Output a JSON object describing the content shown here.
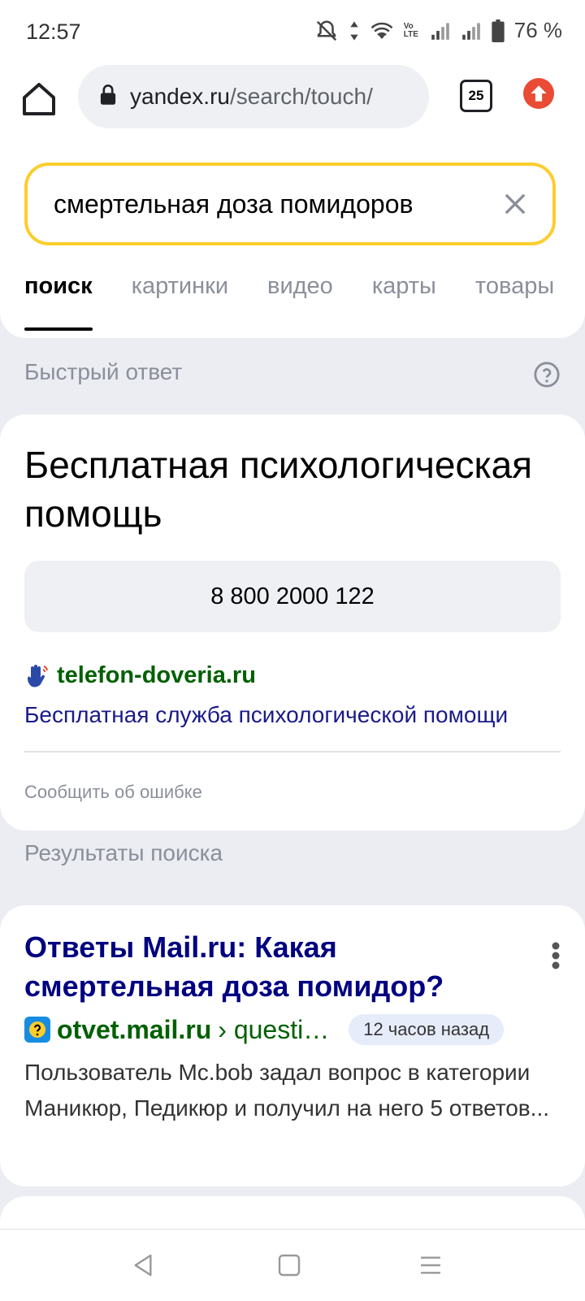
{
  "status": {
    "time": "12:57",
    "battery": "76 %",
    "volte": "Vo LTE"
  },
  "browser": {
    "url_domain": "yandex.ru",
    "url_path": "/search/touch/",
    "tab_count": "25"
  },
  "search": {
    "query": "смертельная доза помидоров",
    "tabs": [
      "поиск",
      "картинки",
      "видео",
      "карты",
      "товары"
    ],
    "active_tab": "поиск"
  },
  "quick_answer": {
    "header": "Быстрый ответ",
    "title": "Бесплатная психологическая помощь",
    "phone": "8 800 2000 122",
    "source_domain": "telefon-doveria.ru",
    "source_desc": "Бесплатная служба психологической помощи",
    "report": "Сообщить об ошибке"
  },
  "results": {
    "header": "Результаты поиска",
    "items": [
      {
        "title": "Ответы Mail.ru: Какая смертельная доза помидор?",
        "domain": "otvet.mail.ru",
        "path": "› questi…",
        "time": "12 часов назад",
        "snippet": "Пользователь Mc.bob задал вопрос в категории Маникюр, Педикюр и получил на него 5 ответов..."
      }
    ]
  },
  "colors": {
    "accent_yellow": "#fdcd2d",
    "link_blue": "#000080",
    "domain_green": "#006000",
    "update_red": "#e94b35"
  }
}
